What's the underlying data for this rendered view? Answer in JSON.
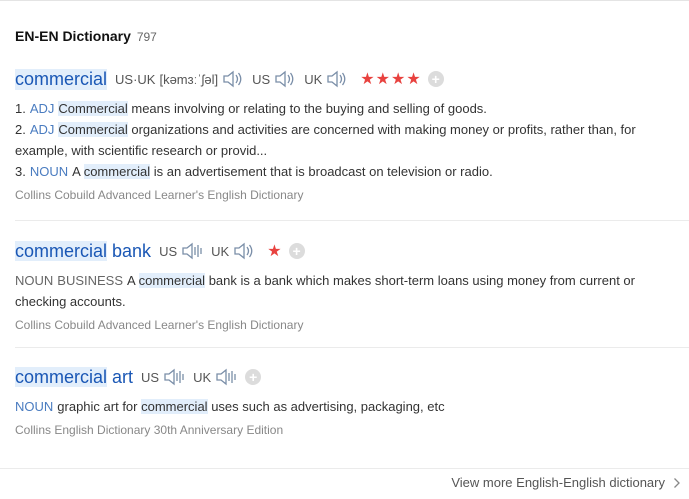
{
  "header": {
    "title": "EN-EN Dictionary",
    "count": "797"
  },
  "entries": [
    {
      "headword": "commercial",
      "pron_us_uk": "US·UK",
      "phonetic": "[kəmɜːˈʃəl]",
      "us_label": "US",
      "uk_label": "UK",
      "stars": "★★★★",
      "defs": [
        {
          "num": "1.",
          "pos": "ADJ",
          "kw": "Commercial",
          "text": " means involving or relating to the buying and selling of goods."
        },
        {
          "num": "2.",
          "pos": "ADJ",
          "kw": "Commercial",
          "text": " organizations and activities are concerned with making money or profits, rather than, for",
          "text2": "example, with scientific research or provid..."
        },
        {
          "num": "3.",
          "pos": "NOUN",
          "pre": "A ",
          "kw": "commercial",
          "text": " is an advertisement that is broadcast on television or radio."
        }
      ],
      "source": "Collins Cobuild Advanced Learner's English Dictionary"
    },
    {
      "headword_a": "commercial",
      "headword_b": " bank",
      "us_label": "US",
      "uk_label": "UK",
      "stars": "★",
      "pos": "NOUN",
      "field": "BUSINESS",
      "pre": "A ",
      "kw": "commercial",
      "text": " bank is a bank which makes short-term loans using money from current or",
      "text2": "checking accounts.",
      "source": "Collins Cobuild Advanced Learner's English Dictionary"
    },
    {
      "headword_a": "commercial",
      "headword_b": " art",
      "us_label": "US",
      "uk_label": "UK",
      "pos": "NOUN",
      "pre": "graphic art for ",
      "kw": "commercial",
      "text": " uses such as advertising, packaging, etc",
      "source": "Collins English Dictionary 30th Anniversary Edition"
    }
  ],
  "footer": {
    "view_more": "View more English-English dictionary"
  },
  "colors": {
    "headword": "#1a57b5",
    "pos": "#4a7cc0",
    "stars": "#e8423f",
    "highlight": "#e2eefb"
  },
  "icons": {
    "speaker": "speaker-icon",
    "add": "add-icon",
    "chevron": "chevron-right-icon"
  }
}
